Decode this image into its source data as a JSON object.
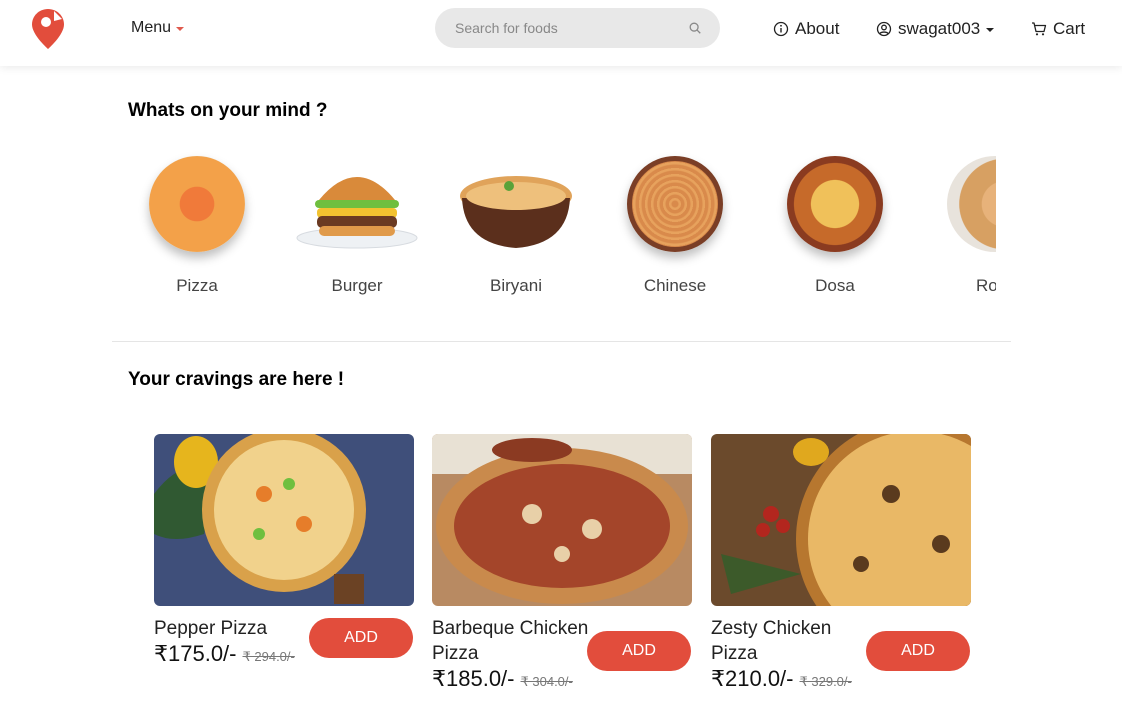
{
  "navbar": {
    "menu_label": "Menu",
    "search_placeholder": "Search for foods",
    "about_label": "About",
    "username": "swagat003",
    "cart_label": "Cart"
  },
  "colors": {
    "accent": "#e24d3c",
    "caret": "#e05a4d",
    "search_bg": "#e8e8e8"
  },
  "mind_section": {
    "title": "Whats on your mind ?",
    "categories": [
      {
        "label": "Pizza"
      },
      {
        "label": "Burger"
      },
      {
        "label": "Biryani"
      },
      {
        "label": "Chinese"
      },
      {
        "label": "Dosa"
      },
      {
        "label": "Ro"
      }
    ]
  },
  "cravings_section": {
    "title": "Your cravings are here !",
    "items": [
      {
        "name": "Pepper Pizza",
        "price": "₹175.0/-",
        "old_price": "₹ 294.0/-",
        "button": "ADD"
      },
      {
        "name": "Barbeque Chicken Pizza",
        "price": "₹185.0/-",
        "old_price": "₹ 304.0/-",
        "button": "ADD"
      },
      {
        "name": "Zesty Chicken Pizza",
        "price": "₹210.0/-",
        "old_price": "₹ 329.0/-",
        "button": "ADD"
      }
    ]
  }
}
